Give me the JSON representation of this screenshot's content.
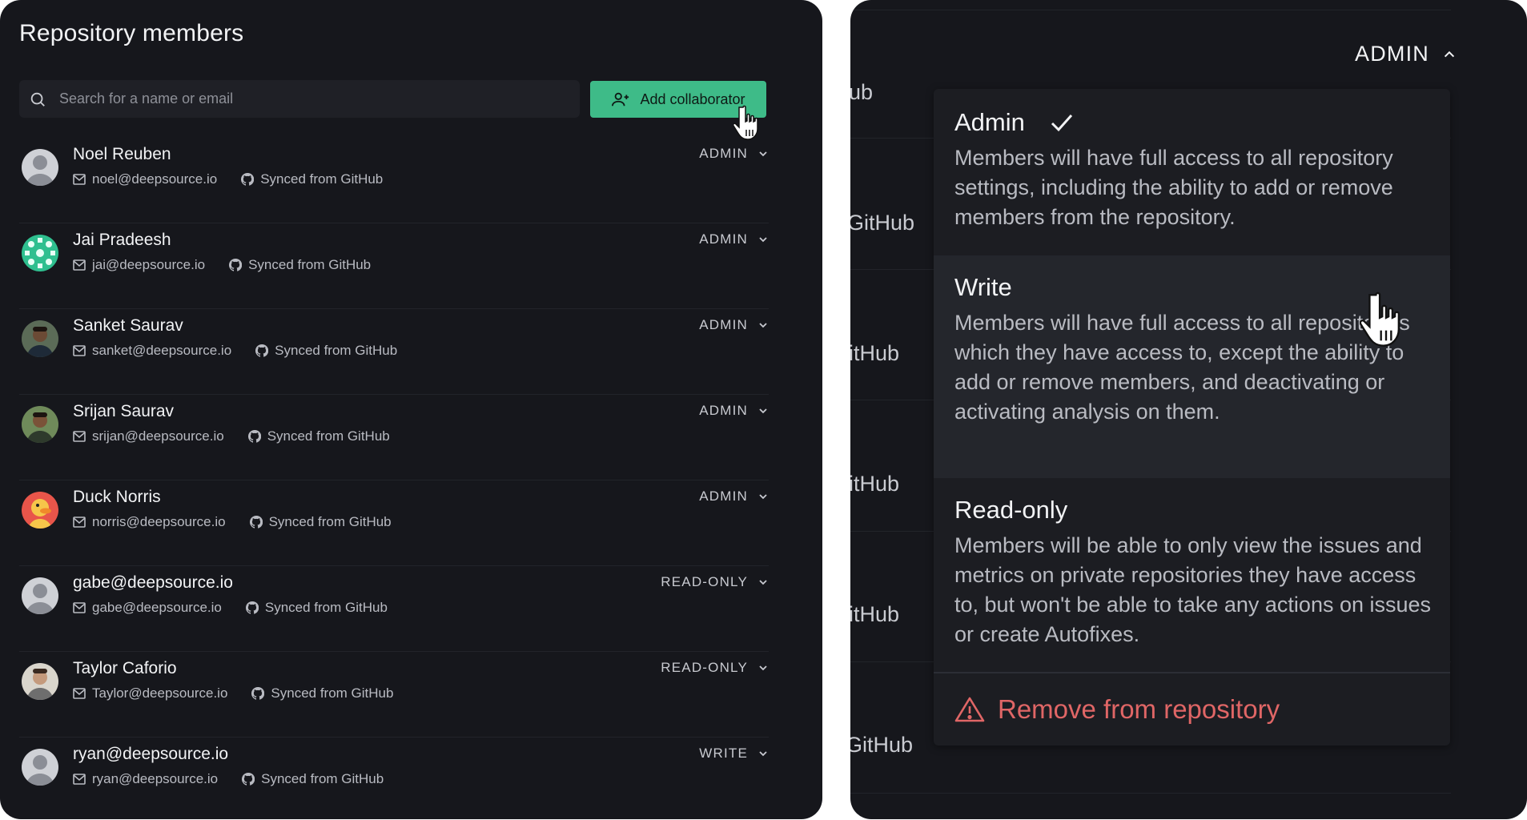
{
  "left_panel": {
    "title": "Repository members",
    "search": {
      "placeholder": "Search for a name or email",
      "icon": "search-icon"
    },
    "add_button": {
      "label": "Add collaborator",
      "icon": "user-plus-icon"
    },
    "members": [
      {
        "name": "Noel Reuben",
        "email": "noel@deepsource.io",
        "sync": "Synced from GitHub",
        "role": "ADMIN",
        "avatar": "default"
      },
      {
        "name": "Jai Pradeesh",
        "email": "jai@deepsource.io",
        "sync": "Synced from GitHub",
        "role": "ADMIN",
        "avatar": "green-pattern"
      },
      {
        "name": "Sanket Saurav",
        "email": "sanket@deepsource.io",
        "sync": "Synced from GitHub",
        "role": "ADMIN",
        "avatar": "photo"
      },
      {
        "name": "Srijan Saurav",
        "email": "srijan@deepsource.io",
        "sync": "Synced from GitHub",
        "role": "ADMIN",
        "avatar": "photo-green"
      },
      {
        "name": "Duck Norris",
        "email": "norris@deepsource.io",
        "sync": "Synced from GitHub",
        "role": "ADMIN",
        "avatar": "duck"
      },
      {
        "name": "gabe@deepsource.io",
        "email": "gabe@deepsource.io",
        "sync": "Synced from GitHub",
        "role": "READ-ONLY",
        "avatar": "default"
      },
      {
        "name": "Taylor Caforio",
        "email": "Taylor@deepsource.io",
        "sync": "Synced from GitHub",
        "role": "READ-ONLY",
        "avatar": "photo-light"
      },
      {
        "name": "ryan@deepsource.io",
        "email": "ryan@deepsource.io",
        "sync": "Synced from GitHub",
        "role": "WRITE",
        "avatar": "default"
      }
    ]
  },
  "right_panel": {
    "current_role": "ADMIN",
    "background_fragments": [
      "ub",
      "GitHub",
      "itHub",
      "itHub",
      "itHub",
      "GitHub"
    ],
    "options": [
      {
        "title": "Admin",
        "selected": true,
        "description": "Members will have full access to all repository settings, including the ability to add or remove members from the repository."
      },
      {
        "title": "Write",
        "selected": false,
        "hovered": true,
        "description": "Members will have full access to all repositories which they have access to, except the ability to add or remove members, and deactivating or activating analysis on them."
      },
      {
        "title": "Read-only",
        "selected": false,
        "description": "Members will be able to only view the issues and metrics on private repositories they have access to, but won't be able to take any actions on issues or create Autofixes."
      }
    ],
    "remove_label": "Remove from repository"
  },
  "colors": {
    "accent": "#3ebb88",
    "danger": "#e06666",
    "panel": "#16171c"
  }
}
